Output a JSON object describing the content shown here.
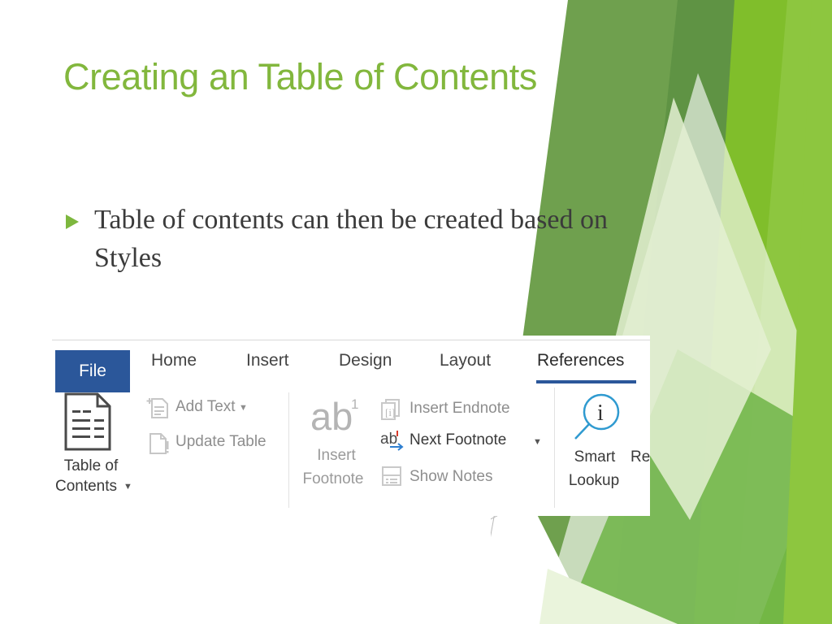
{
  "slide": {
    "title": "Creating an Table of Contents",
    "bullets": [
      "Table of contents can then be created based on Styles"
    ],
    "theme": {
      "title_color": "#82B73D",
      "bullet_color": "#7DB73E",
      "body_color": "#3b3b3b",
      "deco_green_dark": "#6FA04E",
      "deco_green_mid": "#76B82A",
      "deco_green_bright": "#8DC63F",
      "deco_green_pale": "#D9E9C2",
      "background": "#ffffff"
    }
  },
  "ribbon": {
    "tabs": [
      {
        "label": "File",
        "active": false,
        "is_file": true
      },
      {
        "label": "Home",
        "active": false
      },
      {
        "label": "Insert",
        "active": false
      },
      {
        "label": "Design",
        "active": false
      },
      {
        "label": "Layout",
        "active": false
      },
      {
        "label": "References",
        "active": true
      }
    ],
    "groups": {
      "table_of_contents": {
        "gallery_button": {
          "label_line1": "Table of",
          "label_line2": "Contents",
          "has_dropdown": true,
          "icon": "document-list-icon",
          "enabled": true
        },
        "commands": [
          {
            "label": "Add Text",
            "has_dropdown": true,
            "enabled": false,
            "icon": "add-text-icon"
          },
          {
            "label": "Update Table",
            "has_dropdown": false,
            "enabled": false,
            "icon": "update-table-icon"
          }
        ]
      },
      "footnotes": {
        "insert_footnote": {
          "glyph": "ab",
          "superscript": "1",
          "label_line1": "Insert",
          "label_line2": "Footnote",
          "enabled": false,
          "icon": "insert-footnote-icon"
        },
        "commands": [
          {
            "label": "Insert Endnote",
            "has_dropdown": false,
            "enabled": false,
            "icon": "insert-endnote-icon"
          },
          {
            "label": "Next Footnote",
            "has_dropdown": true,
            "enabled": true,
            "icon": "next-footnote-icon"
          },
          {
            "label": "Show Notes",
            "has_dropdown": false,
            "enabled": false,
            "icon": "show-notes-icon"
          }
        ]
      },
      "research": {
        "smart_lookup": {
          "label_line1": "Smart",
          "label_line2": "Lookup",
          "enabled": true,
          "icon": "smart-lookup-magnifier-icon"
        },
        "truncated_command": {
          "label": "Re"
        }
      }
    }
  }
}
